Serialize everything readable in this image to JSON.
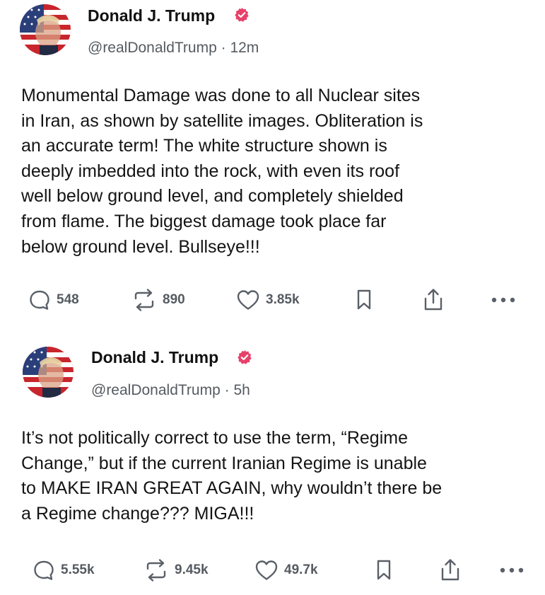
{
  "colors": {
    "verified": "#e8406a",
    "icon": "#5a6068",
    "text": "#141414",
    "muted": "#555b61"
  },
  "posts": [
    {
      "author": "Donald J. Trump",
      "handle": "@realDonaldTrump",
      "time": "12m",
      "text": "Monumental Damage was done to all Nuclear sites\nin Iran, as shown by satellite images. Obliteration is\nan accurate term! The white structure shown is\ndeeply imbedded into the rock, with even its roof\nwell below ground level, and completely shielded\nfrom flame. The biggest damage took place far\nbelow ground level. Bullseye!!!",
      "replies": "548",
      "retruths": "890",
      "likes": "3.85k"
    },
    {
      "author": "Donald J. Trump",
      "handle": "@realDonaldTrump",
      "time": "5h",
      "text": "It’s not politically correct to use the term, “Regime\nChange,” but if the current Iranian Regime is unable\nto MAKE IRAN GREAT AGAIN, why wouldn’t there be\na Regime change??? MIGA!!!",
      "replies": "5.55k",
      "retruths": "9.45k",
      "likes": "49.7k"
    }
  ],
  "icons": [
    "avatar",
    "verified-badge-icon",
    "reply-icon",
    "retruth-icon",
    "heart-icon",
    "bookmark-icon",
    "share-icon",
    "more-icon"
  ]
}
